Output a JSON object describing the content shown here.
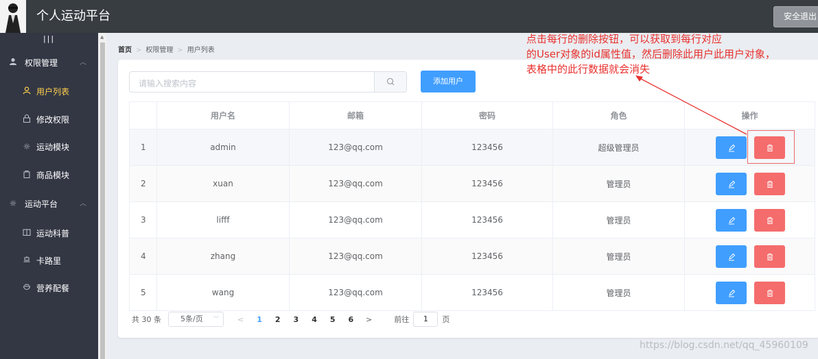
{
  "header": {
    "title": "个人运动平台",
    "logout": "安全退出"
  },
  "sidebar": {
    "toggle": "|||",
    "items": [
      {
        "label": "权限管理",
        "icon": "user-icon",
        "type": "group"
      },
      {
        "label": "用户列表",
        "icon": "user-outline-icon",
        "type": "sub",
        "active": true
      },
      {
        "label": "修改权限",
        "icon": "lock-icon",
        "type": "sub"
      },
      {
        "label": "运动模块",
        "icon": "sun-icon",
        "type": "sub"
      },
      {
        "label": "商品模块",
        "icon": "goods-icon",
        "type": "sub"
      },
      {
        "label": "运动平台",
        "icon": "sun-icon",
        "type": "group"
      },
      {
        "label": "运动科普",
        "icon": "notebook-icon",
        "type": "sub"
      },
      {
        "label": "卡路里",
        "icon": "food-icon",
        "type": "sub"
      },
      {
        "label": "营养配餐",
        "icon": "bowl-icon",
        "type": "sub"
      }
    ],
    "active_color": "#ffd04b"
  },
  "breadcrumb": [
    "首页",
    "权限管理",
    "用户列表"
  ],
  "annotation": {
    "lines": [
      "点击每行的删除按钮，可以获取到每行对应",
      "的User对象的id属性值，然后删除此用户此用户对象，",
      "表格中的此行数据就会消失"
    ],
    "color": "#e8312f"
  },
  "search": {
    "placeholder": "请输入搜索内容"
  },
  "add_button": "添加用户",
  "table": {
    "columns": [
      "",
      "用户名",
      "邮箱",
      "密码",
      "角色",
      "操作"
    ],
    "rows": [
      {
        "index": "1",
        "username": "admin",
        "email": "123@qq.com",
        "password": "123456",
        "role": "超级管理员"
      },
      {
        "index": "2",
        "username": "xuan",
        "email": "123@qq.com",
        "password": "123456",
        "role": "管理员"
      },
      {
        "index": "3",
        "username": "lifff",
        "email": "123@qq.com",
        "password": "123456",
        "role": "管理员"
      },
      {
        "index": "4",
        "username": "zhang",
        "email": "123@qq.com",
        "password": "123456",
        "role": "管理员"
      },
      {
        "index": "5",
        "username": "wang",
        "email": "123@qq.com",
        "password": "123456",
        "role": "管理员"
      }
    ]
  },
  "pagination": {
    "total": "共 30 条",
    "page_size": "5条/页",
    "pages": [
      "1",
      "2",
      "3",
      "4",
      "5",
      "6"
    ],
    "current": "1",
    "goto_label": "前往",
    "goto_value": "1",
    "goto_unit": "页"
  },
  "watermark": "https://blog.csdn.net/qq_45960109",
  "colors": {
    "primary": "#409eff",
    "danger": "#f56c6c",
    "header_bg": "#373d41",
    "sidebar_bg": "#333744"
  }
}
